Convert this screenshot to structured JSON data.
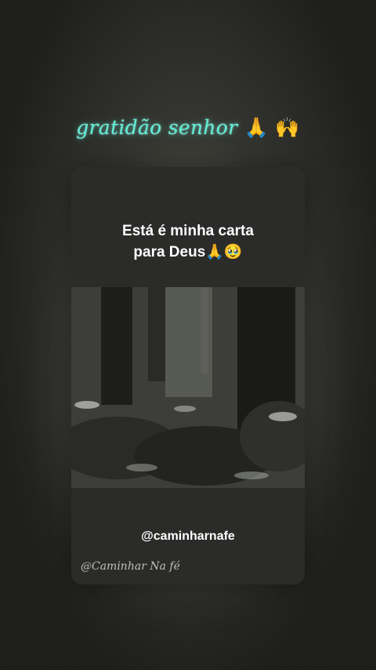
{
  "caption": {
    "text": "gratidão senhor",
    "emojis": "🙏 🙌",
    "color": "#5ff0d8"
  },
  "card": {
    "title_line1": "Está é minha carta",
    "title_line2": "para Deus🙏🥹",
    "handle": "@caminharnafe",
    "watermark": "@Caminhar Na fé"
  }
}
